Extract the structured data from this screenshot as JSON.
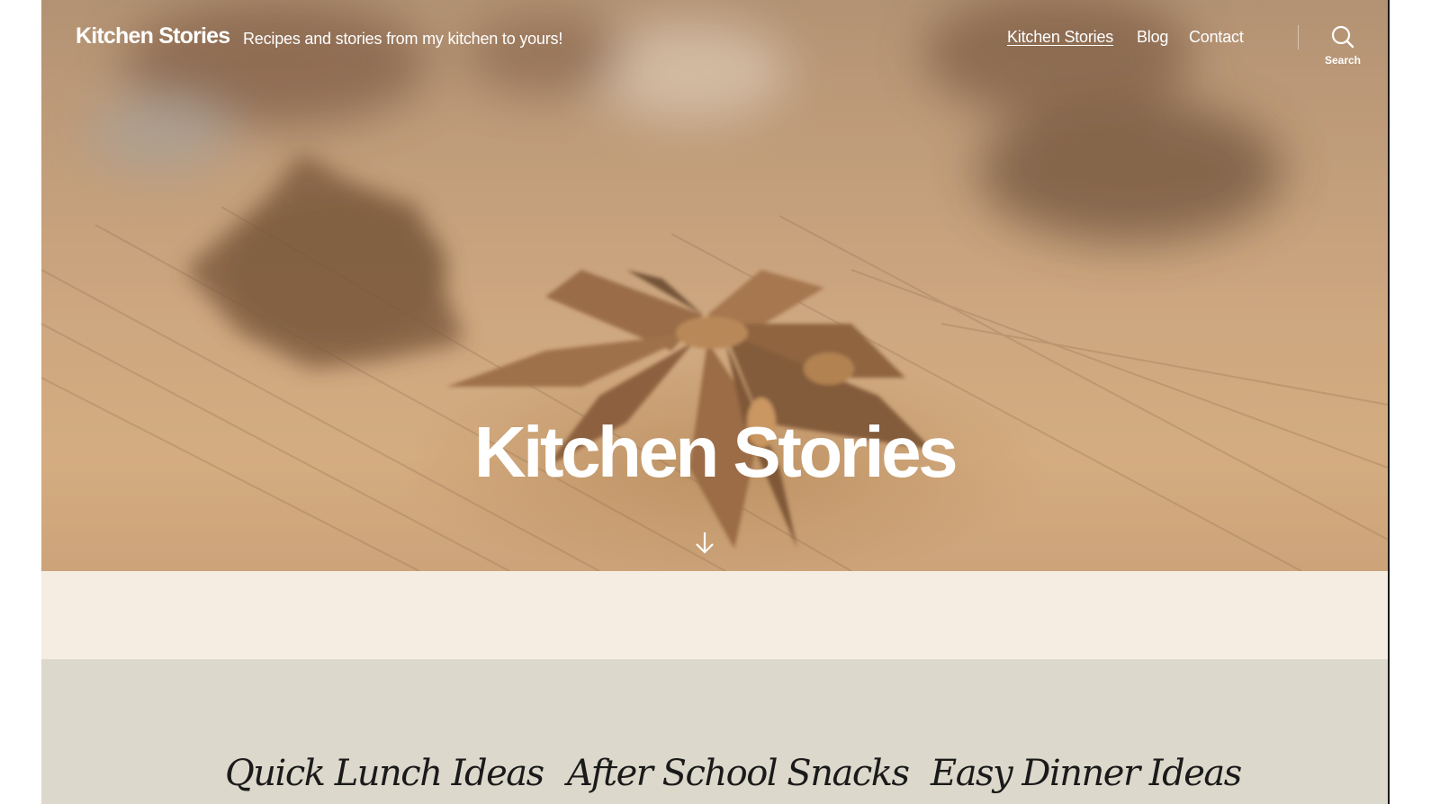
{
  "header": {
    "site_title": "Kitchen Stories",
    "tagline": "Recipes and stories from my kitchen to yours!",
    "nav": [
      {
        "label": "Kitchen Stories",
        "current": true
      },
      {
        "label": "Blog",
        "current": false
      },
      {
        "label": "Contact",
        "current": false
      }
    ],
    "search": {
      "label": "Search",
      "icon": "search-icon"
    }
  },
  "hero": {
    "image": "star-anise-on-wooden-surface",
    "heading": "Kitchen Stories",
    "scroll_icon": "arrow-down-icon"
  },
  "categories": [
    {
      "label": "Quick Lunch Ideas"
    },
    {
      "label": "After School Snacks"
    },
    {
      "label": "Easy Dinner Ideas"
    }
  ],
  "colors": {
    "header_text": "#ffffff",
    "content_background": "#f5ede2",
    "category_band": "#dcd8cb",
    "category_text": "#1a1a1a"
  }
}
